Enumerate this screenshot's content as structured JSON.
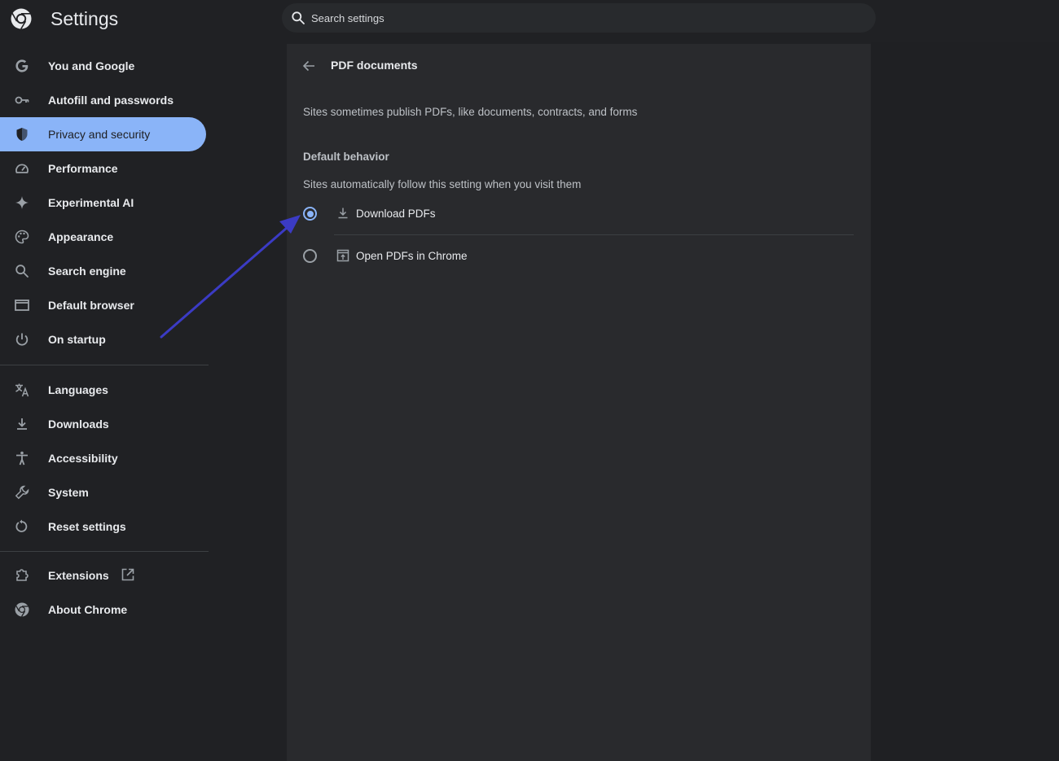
{
  "header": {
    "title": "Settings",
    "search_placeholder": "Search settings",
    "logo_icon": "chrome-logo-icon",
    "search_icon": "search-icon"
  },
  "sidebar": {
    "items": [
      {
        "label": "You and Google",
        "icon": "google-g-icon",
        "active": false
      },
      {
        "label": "Autofill and passwords",
        "icon": "key-icon",
        "active": false
      },
      {
        "label": "Privacy and security",
        "icon": "shield-icon",
        "active": true
      },
      {
        "label": "Performance",
        "icon": "speedometer-icon",
        "active": false
      },
      {
        "label": "Experimental AI",
        "icon": "sparkle-icon",
        "active": false
      },
      {
        "label": "Appearance",
        "icon": "palette-icon",
        "active": false
      },
      {
        "label": "Search engine",
        "icon": "search-icon",
        "active": false
      },
      {
        "label": "Default browser",
        "icon": "browser-window-icon",
        "active": false
      },
      {
        "label": "On startup",
        "icon": "power-icon",
        "active": false
      },
      {
        "label": "Languages",
        "icon": "translate-icon",
        "active": false
      },
      {
        "label": "Downloads",
        "icon": "download-icon",
        "active": false
      },
      {
        "label": "Accessibility",
        "icon": "accessibility-icon",
        "active": false
      },
      {
        "label": "System",
        "icon": "wrench-icon",
        "active": false
      },
      {
        "label": "Reset settings",
        "icon": "reset-icon",
        "active": false
      },
      {
        "label": "Extensions",
        "icon": "puzzle-icon",
        "active": false
      },
      {
        "label": "About Chrome",
        "icon": "chrome-icon",
        "active": false
      }
    ]
  },
  "main": {
    "title": "PDF documents",
    "description": "Sites sometimes publish PDFs, like documents, contracts, and forms",
    "section_heading": "Default behavior",
    "section_sub": "Sites automatically follow this setting when you visit them",
    "options": [
      {
        "label": "Download PDFs",
        "icon": "download-icon",
        "selected": true
      },
      {
        "label": "Open PDFs in Chrome",
        "icon": "open-in-browser-icon",
        "selected": false
      }
    ]
  },
  "colors": {
    "background": "#202124",
    "card": "#292a2d",
    "accent": "#8ab4f8",
    "annotation_arrow": "#3b3bc4"
  }
}
